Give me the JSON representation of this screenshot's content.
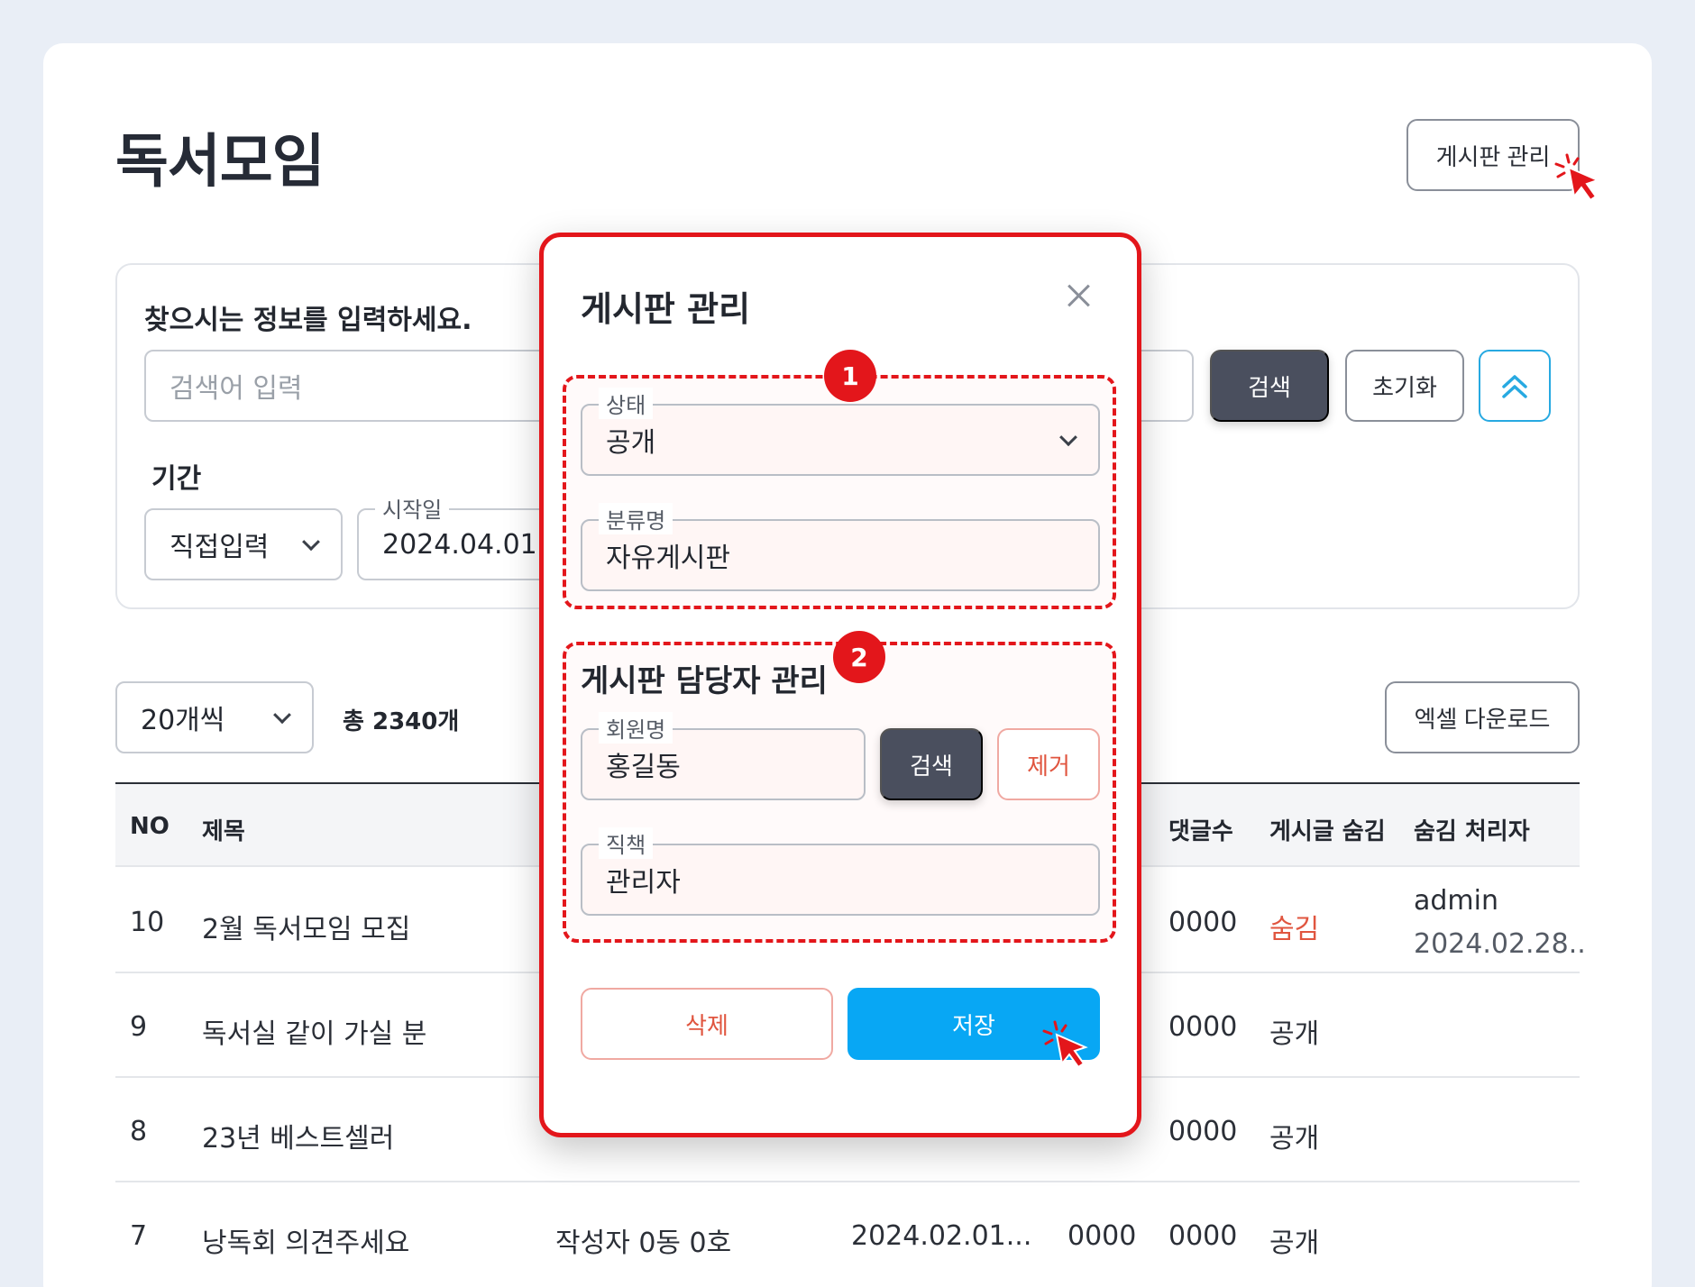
{
  "page": {
    "title": "독서모임",
    "board_manage_button": "게시판 관리"
  },
  "search": {
    "heading": "찾으시는 정보를 입력하세요.",
    "keyword_placeholder": "검색어 입력",
    "period_label": "기간",
    "period_type": "직접입력",
    "start_date_label": "시작일",
    "start_date_value": "2024.04.01",
    "search_button": "검색",
    "reset_button": "초기화"
  },
  "list": {
    "per_page": "20개씩",
    "total": "총 2340개",
    "excel_button": "엑셀 다운로드",
    "columns": {
      "no": "NO",
      "title": "제목",
      "comments": "댓글수",
      "hide": "게시글 숨김",
      "hidden_by": "숨김 처리자"
    },
    "rows": [
      {
        "no": "10",
        "title": "2월 독서모임 모집",
        "comments": "0000",
        "status": "숨김",
        "hidden_by": "admin",
        "hidden_date": "2024.02.28.."
      },
      {
        "no": "9",
        "title": "독서실 같이 가실 분",
        "comments": "0000",
        "status": "공개"
      },
      {
        "no": "8",
        "title": "23년 베스트셀러",
        "comments": "0000",
        "status": "공개"
      },
      {
        "no": "7",
        "title": "낭독회 의견주세요",
        "author": "작성자 0동 0호",
        "date": "2024.02.01...",
        "views": "0000",
        "comments": "0000",
        "status": "공개"
      }
    ]
  },
  "modal": {
    "title": "게시판 관리",
    "step1_badge": "1",
    "step2_badge": "2",
    "status_label": "상태",
    "status_value": "공개",
    "category_label": "분류명",
    "category_value": "자유게시판",
    "manager_section_title": "게시판 담당자 관리",
    "member_label": "회원명",
    "member_value": "홍길동",
    "member_search_button": "검색",
    "member_remove_button": "제거",
    "role_label": "직책",
    "role_value": "관리자",
    "delete_button": "삭제",
    "save_button": "저장"
  },
  "colors": {
    "accent_red": "#e3161b",
    "save_blue": "#08a7f4",
    "hidden_text": "#e0553f"
  }
}
